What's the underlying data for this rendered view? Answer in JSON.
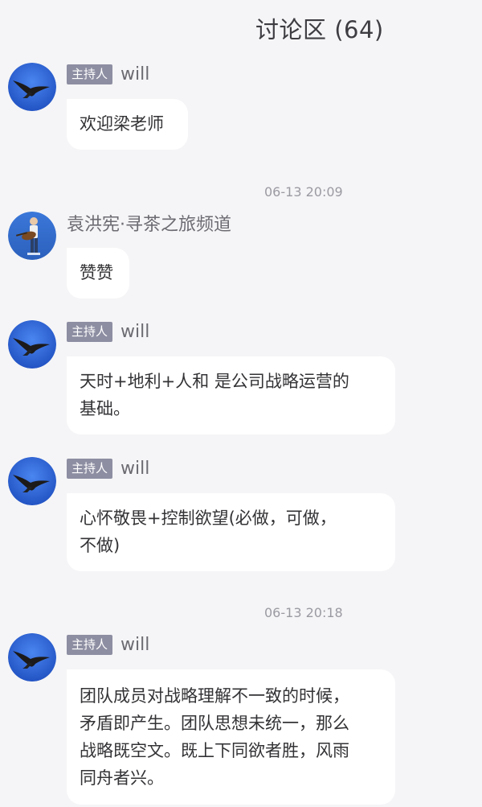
{
  "header": {
    "title": "讨论区 (64)"
  },
  "feed": {
    "timestamps": [
      "06-13 20:09",
      "06-13 20:18"
    ],
    "messages": [
      {
        "host_badge": "主持人",
        "user": "will",
        "avatar": "eagle-avatar",
        "text": "欢迎梁老师"
      },
      {
        "host_badge": "",
        "user": "袁洪宪·寻茶之旅频道",
        "avatar": "guitarist-avatar",
        "text": "赞赞"
      },
      {
        "host_badge": "主持人",
        "user": "will",
        "avatar": "eagle-avatar",
        "text_lines": [
          "天时+地利+人和 是公司战略运营的",
          "基础。"
        ]
      },
      {
        "host_badge": "主持人",
        "user": "will",
        "avatar": "eagle-avatar",
        "text_lines": [
          "心怀敬畏+控制欲望(必做，可做，",
          "不做)"
        ]
      },
      {
        "host_badge": "主持人",
        "user": "will",
        "avatar": "eagle-avatar",
        "text_lines": [
          "团队成员对战略理解不一致的时候，",
          "矛盾即产生。团队思想未统一，那么",
          "战略既空文。既上下同欲者胜，风雨",
          "同舟者兴。"
        ]
      }
    ]
  },
  "colors": {
    "background": "#f5f5f7",
    "bubble": "#ffffff",
    "badge": "#8d8ea2",
    "avatar_blue": "#2f63d6"
  }
}
